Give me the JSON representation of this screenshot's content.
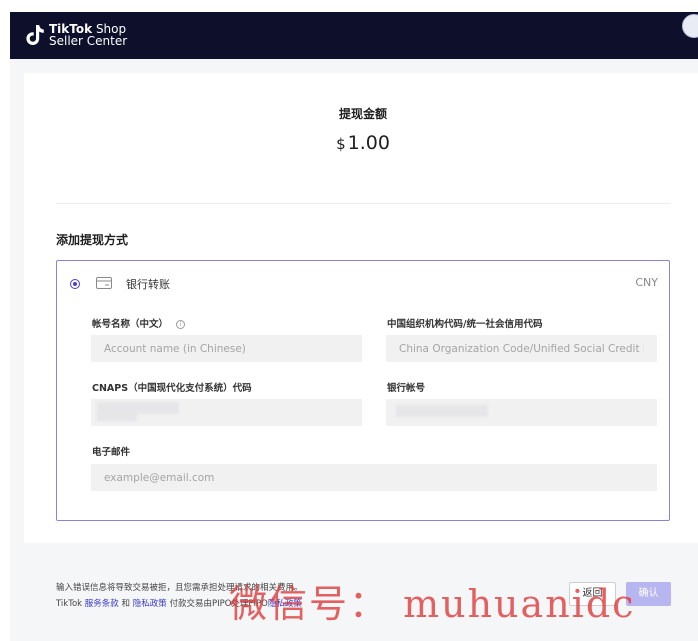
{
  "header": {
    "brand_bold": "TikTok",
    "brand_rest": "Shop",
    "brand_line2": "Seller Center",
    "logo_icon": "tiktok-logo-icon",
    "avatar_icon": "user-avatar-icon"
  },
  "withdraw": {
    "title": "提现金额",
    "currency_symbol": "$",
    "amount": "1.00"
  },
  "method_section": {
    "title": "添加提现方式",
    "method": {
      "icon": "bank-card-icon",
      "label": "银行转账",
      "currency": "CNY",
      "selected": true
    },
    "fields": {
      "account_name": {
        "label": "帐号名称（中文）",
        "info_icon": "info-icon",
        "placeholder": "Account name (in Chinese)"
      },
      "org_code": {
        "label": "中国组织机构代码/统一社会信用代码",
        "placeholder": "China Organization Code/Unified Social Credit Ide"
      },
      "cnaps": {
        "label": "CNAPS（中国现代化支付系统）代码"
      },
      "bank_account": {
        "label": "银行帐号"
      },
      "email": {
        "label": "电子邮件",
        "placeholder": "example@email.com"
      }
    }
  },
  "footer": {
    "warning": "输入错误信息将导致交易被拒，且您需承担处理请求的相关费用。",
    "line2_prefix": "TikTok",
    "terms_link": "服务条款",
    "and": "和",
    "privacy_link": "隐私政策",
    "line2_mid": "付款交易由PIPO处理PIPO",
    "pipo_privacy_link": "隐私政策",
    "back_button": "返回",
    "confirm_button": "确认"
  },
  "watermark": "微信号： muhuanidc",
  "colors": {
    "header_bg": "#0d0f2b",
    "accent": "#4b3fd6",
    "disabled_button": "#b7b6f0",
    "link": "#3a3ac9",
    "watermark": "#de3a3a"
  }
}
